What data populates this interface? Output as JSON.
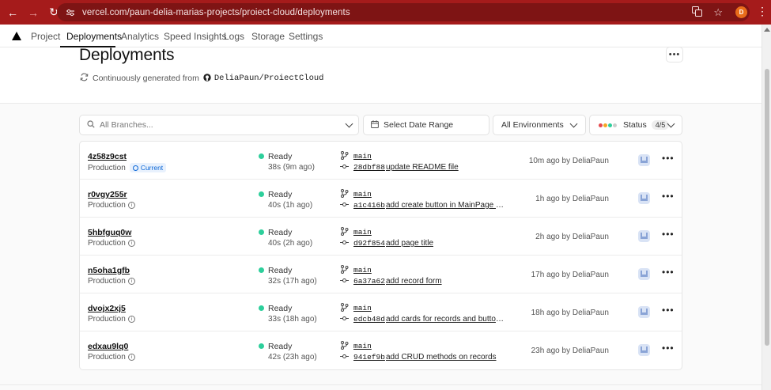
{
  "browser": {
    "url": "vercel.com/paun-delia-marias-projects/proiect-cloud/deployments",
    "profile_initial": "D"
  },
  "nav": {
    "tabs": [
      {
        "label": "Project"
      },
      {
        "label": "Deployments"
      },
      {
        "label": "Analytics"
      },
      {
        "label": "Speed Insights"
      },
      {
        "label": "Logs"
      },
      {
        "label": "Storage"
      },
      {
        "label": "Settings"
      }
    ],
    "active_tab": "Deployments"
  },
  "header": {
    "title": "Deployments",
    "generated_prefix": "Continuously generated from",
    "repo": "DeliaPaun/ProiectCloud"
  },
  "filters": {
    "branches_placeholder": "All Branches...",
    "date_range": "Select Date Range",
    "environments": "All Environments",
    "status_label": "Status",
    "status_count": "4/5"
  },
  "deployments": [
    {
      "id": "4z58z9cst",
      "env": "Production",
      "current": true,
      "current_label": "Current",
      "status": "Ready",
      "duration": "38s (9m ago)",
      "branch": "main",
      "sha": "28dbf88",
      "message": "update README file",
      "meta": "10m ago by DeliaPaun"
    },
    {
      "id": "r0vgy255r",
      "env": "Production",
      "current": false,
      "status": "Ready",
      "duration": "40s (1h ago)",
      "branch": "main",
      "sha": "a1c416b",
      "message": "add create button in MainPage to r...",
      "meta": "1h ago by DeliaPaun"
    },
    {
      "id": "5hbfguq0w",
      "env": "Production",
      "current": false,
      "status": "Ready",
      "duration": "40s (2h ago)",
      "branch": "main",
      "sha": "d92f854",
      "message": "add page title",
      "meta": "2h ago by DeliaPaun"
    },
    {
      "id": "n5oha1gfb",
      "env": "Production",
      "current": false,
      "status": "Ready",
      "duration": "32s (17h ago)",
      "branch": "main",
      "sha": "6a37a62",
      "message": "add record form",
      "meta": "17h ago by DeliaPaun"
    },
    {
      "id": "dvojx2xj5",
      "env": "Production",
      "current": false,
      "status": "Ready",
      "duration": "33s (18h ago)",
      "branch": "main",
      "sha": "edcb48d",
      "message": "add cards for records and buttons ...",
      "meta": "18h ago by DeliaPaun"
    },
    {
      "id": "edxau9lq0",
      "env": "Production",
      "current": false,
      "status": "Ready",
      "duration": "42s (23h ago)",
      "branch": "main",
      "sha": "941ef9b",
      "message": "add CRUD methods on records",
      "meta": "23h ago by DeliaPaun"
    }
  ],
  "colors": {
    "browser_bar": "#a51b1b",
    "ready": "#2dcf9b",
    "current_badge": "#0a66d6"
  }
}
